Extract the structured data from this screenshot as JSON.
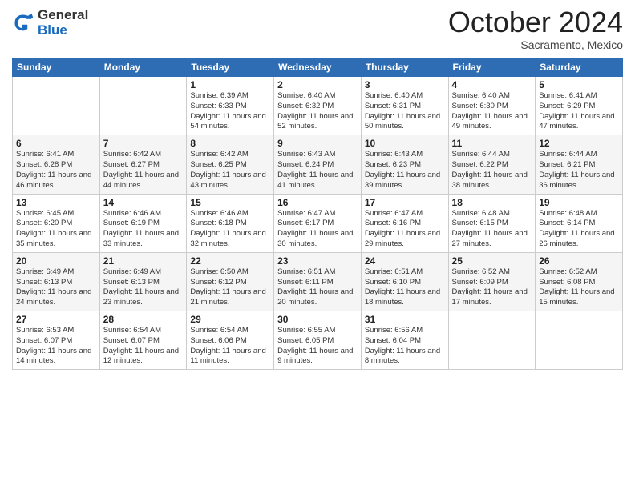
{
  "header": {
    "logo": {
      "line1": "General",
      "line2": "Blue"
    },
    "month": "October 2024",
    "location": "Sacramento, Mexico"
  },
  "days_of_week": [
    "Sunday",
    "Monday",
    "Tuesday",
    "Wednesday",
    "Thursday",
    "Friday",
    "Saturday"
  ],
  "weeks": [
    [
      {
        "day": "",
        "info": ""
      },
      {
        "day": "",
        "info": ""
      },
      {
        "day": "1",
        "info": "Sunrise: 6:39 AM\nSunset: 6:33 PM\nDaylight: 11 hours and 54 minutes."
      },
      {
        "day": "2",
        "info": "Sunrise: 6:40 AM\nSunset: 6:32 PM\nDaylight: 11 hours and 52 minutes."
      },
      {
        "day": "3",
        "info": "Sunrise: 6:40 AM\nSunset: 6:31 PM\nDaylight: 11 hours and 50 minutes."
      },
      {
        "day": "4",
        "info": "Sunrise: 6:40 AM\nSunset: 6:30 PM\nDaylight: 11 hours and 49 minutes."
      },
      {
        "day": "5",
        "info": "Sunrise: 6:41 AM\nSunset: 6:29 PM\nDaylight: 11 hours and 47 minutes."
      }
    ],
    [
      {
        "day": "6",
        "info": "Sunrise: 6:41 AM\nSunset: 6:28 PM\nDaylight: 11 hours and 46 minutes."
      },
      {
        "day": "7",
        "info": "Sunrise: 6:42 AM\nSunset: 6:27 PM\nDaylight: 11 hours and 44 minutes."
      },
      {
        "day": "8",
        "info": "Sunrise: 6:42 AM\nSunset: 6:25 PM\nDaylight: 11 hours and 43 minutes."
      },
      {
        "day": "9",
        "info": "Sunrise: 6:43 AM\nSunset: 6:24 PM\nDaylight: 11 hours and 41 minutes."
      },
      {
        "day": "10",
        "info": "Sunrise: 6:43 AM\nSunset: 6:23 PM\nDaylight: 11 hours and 39 minutes."
      },
      {
        "day": "11",
        "info": "Sunrise: 6:44 AM\nSunset: 6:22 PM\nDaylight: 11 hours and 38 minutes."
      },
      {
        "day": "12",
        "info": "Sunrise: 6:44 AM\nSunset: 6:21 PM\nDaylight: 11 hours and 36 minutes."
      }
    ],
    [
      {
        "day": "13",
        "info": "Sunrise: 6:45 AM\nSunset: 6:20 PM\nDaylight: 11 hours and 35 minutes."
      },
      {
        "day": "14",
        "info": "Sunrise: 6:46 AM\nSunset: 6:19 PM\nDaylight: 11 hours and 33 minutes."
      },
      {
        "day": "15",
        "info": "Sunrise: 6:46 AM\nSunset: 6:18 PM\nDaylight: 11 hours and 32 minutes."
      },
      {
        "day": "16",
        "info": "Sunrise: 6:47 AM\nSunset: 6:17 PM\nDaylight: 11 hours and 30 minutes."
      },
      {
        "day": "17",
        "info": "Sunrise: 6:47 AM\nSunset: 6:16 PM\nDaylight: 11 hours and 29 minutes."
      },
      {
        "day": "18",
        "info": "Sunrise: 6:48 AM\nSunset: 6:15 PM\nDaylight: 11 hours and 27 minutes."
      },
      {
        "day": "19",
        "info": "Sunrise: 6:48 AM\nSunset: 6:14 PM\nDaylight: 11 hours and 26 minutes."
      }
    ],
    [
      {
        "day": "20",
        "info": "Sunrise: 6:49 AM\nSunset: 6:13 PM\nDaylight: 11 hours and 24 minutes."
      },
      {
        "day": "21",
        "info": "Sunrise: 6:49 AM\nSunset: 6:13 PM\nDaylight: 11 hours and 23 minutes."
      },
      {
        "day": "22",
        "info": "Sunrise: 6:50 AM\nSunset: 6:12 PM\nDaylight: 11 hours and 21 minutes."
      },
      {
        "day": "23",
        "info": "Sunrise: 6:51 AM\nSunset: 6:11 PM\nDaylight: 11 hours and 20 minutes."
      },
      {
        "day": "24",
        "info": "Sunrise: 6:51 AM\nSunset: 6:10 PM\nDaylight: 11 hours and 18 minutes."
      },
      {
        "day": "25",
        "info": "Sunrise: 6:52 AM\nSunset: 6:09 PM\nDaylight: 11 hours and 17 minutes."
      },
      {
        "day": "26",
        "info": "Sunrise: 6:52 AM\nSunset: 6:08 PM\nDaylight: 11 hours and 15 minutes."
      }
    ],
    [
      {
        "day": "27",
        "info": "Sunrise: 6:53 AM\nSunset: 6:07 PM\nDaylight: 11 hours and 14 minutes."
      },
      {
        "day": "28",
        "info": "Sunrise: 6:54 AM\nSunset: 6:07 PM\nDaylight: 11 hours and 12 minutes."
      },
      {
        "day": "29",
        "info": "Sunrise: 6:54 AM\nSunset: 6:06 PM\nDaylight: 11 hours and 11 minutes."
      },
      {
        "day": "30",
        "info": "Sunrise: 6:55 AM\nSunset: 6:05 PM\nDaylight: 11 hours and 9 minutes."
      },
      {
        "day": "31",
        "info": "Sunrise: 6:56 AM\nSunset: 6:04 PM\nDaylight: 11 hours and 8 minutes."
      },
      {
        "day": "",
        "info": ""
      },
      {
        "day": "",
        "info": ""
      }
    ]
  ]
}
